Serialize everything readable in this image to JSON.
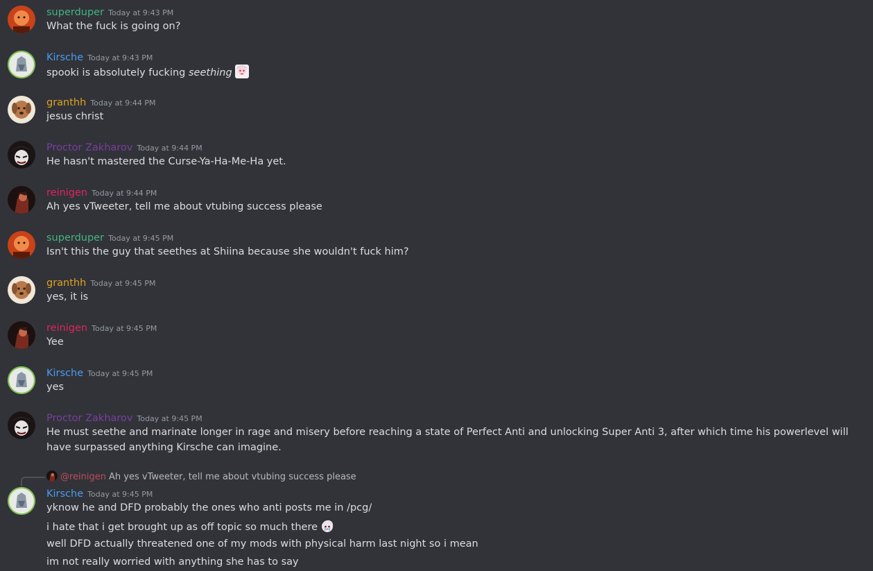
{
  "colors": {
    "background": "#313338",
    "text": "#dbdee1",
    "timestamp": "#949ba4",
    "superduper": "#43b581",
    "Kirsche": "#4a9cf0",
    "granthh": "#e0a31f",
    "Proctor Zakharov": "#7a3ea1",
    "reinigen": "#e0245e"
  },
  "messages": [
    {
      "author": "superduper",
      "timestamp": "Today at 9:43 PM",
      "lines": [
        "What the fuck is going on?"
      ]
    },
    {
      "author": "Kirsche",
      "timestamp": "Today at 9:43 PM",
      "line_prefix": "spooki is absolutely fucking ",
      "line_italic": "seething",
      "emoji": "anime-girl-emoji"
    },
    {
      "author": "granthh",
      "timestamp": "Today at 9:44 PM",
      "lines": [
        "jesus christ"
      ]
    },
    {
      "author": "Proctor Zakharov",
      "timestamp": "Today at 9:44 PM",
      "lines": [
        "He hasn't mastered the Curse-Ya-Ha-Me-Ha yet."
      ]
    },
    {
      "author": "reinigen",
      "timestamp": "Today at 9:44 PM",
      "lines": [
        "Ah yes vTweeter, tell me about vtubing success please"
      ]
    },
    {
      "author": "superduper",
      "timestamp": "Today at 9:45 PM",
      "lines": [
        "Isn't this the guy that seethes at Shiina because she wouldn't fuck him?"
      ]
    },
    {
      "author": "granthh",
      "timestamp": "Today at 9:45 PM",
      "lines": [
        "yes, it is"
      ]
    },
    {
      "author": "reinigen",
      "timestamp": "Today at 9:45 PM",
      "lines": [
        "Yee"
      ]
    },
    {
      "author": "Kirsche",
      "timestamp": "Today at 9:45 PM",
      "lines": [
        "yes"
      ]
    },
    {
      "author": "Proctor Zakharov",
      "timestamp": "Today at 9:45 PM",
      "lines": [
        "He must seethe and marinate longer in rage and misery before reaching a state of Perfect Anti and unlocking Super Anti 3, after which time his powerlevel will have surpassed anything Kirsche can imagine."
      ]
    },
    {
      "reply": {
        "mention": "@reinigen",
        "text": "Ah yes vTweeter, tell me about vtubing success please"
      },
      "author": "Kirsche",
      "timestamp": "Today at 9:45 PM",
      "lines": [
        "yknow he and DFD probably the ones who anti posts me in /pcg/",
        "i hate that i get brought up as off topic so much there",
        "well DFD actually threatened one of my mods with physical harm last night so i mean",
        "im not really worried with anything she has to say"
      ],
      "line2_emoji": "crying-anime-emoji"
    }
  ]
}
